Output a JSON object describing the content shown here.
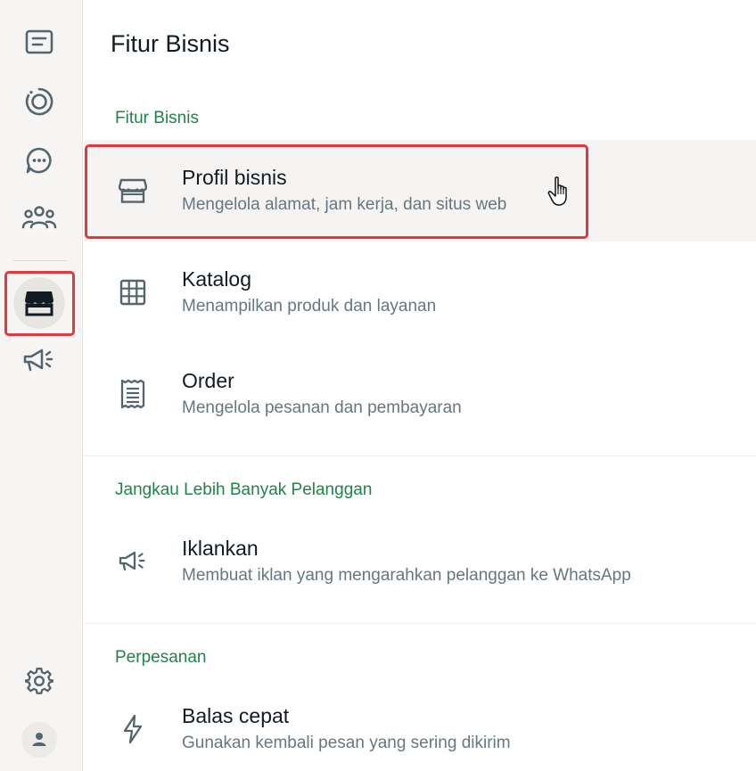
{
  "page": {
    "title": "Fitur Bisnis"
  },
  "sidebar": {
    "items": [
      {
        "name": "chats",
        "icon": "chat-list-icon"
      },
      {
        "name": "status",
        "icon": "status-icon"
      },
      {
        "name": "channels",
        "icon": "channels-icon"
      },
      {
        "name": "communities",
        "icon": "communities-icon"
      },
      {
        "name": "business-tools",
        "icon": "storefront-icon",
        "active": true
      },
      {
        "name": "ads",
        "icon": "megaphone-icon"
      }
    ],
    "bottom": [
      {
        "name": "settings",
        "icon": "gear-icon"
      },
      {
        "name": "profile",
        "icon": "avatar-icon"
      }
    ]
  },
  "sections": [
    {
      "header": "Fitur Bisnis",
      "items": [
        {
          "title": "Profil bisnis",
          "subtitle": "Mengelola alamat, jam kerja, dan situs web",
          "icon": "storefront-icon"
        },
        {
          "title": "Katalog",
          "subtitle": "Menampilkan produk dan layanan",
          "icon": "grid-icon"
        },
        {
          "title": "Order",
          "subtitle": "Mengelola pesanan dan pembayaran",
          "icon": "receipt-icon"
        }
      ]
    },
    {
      "header": "Jangkau Lebih Banyak Pelanggan",
      "items": [
        {
          "title": "Iklankan",
          "subtitle": "Membuat iklan yang mengarahkan pelanggan ke WhatsApp",
          "icon": "megaphone-icon"
        }
      ]
    },
    {
      "header": "Perpesanan",
      "items": [
        {
          "title": "Balas cepat",
          "subtitle": "Gunakan kembali pesan yang sering dikirim",
          "icon": "lightning-icon"
        }
      ]
    }
  ],
  "colors": {
    "accent": "#1f8447",
    "highlight": "#e0393e",
    "text": "#111b21",
    "subtext": "#667781"
  }
}
